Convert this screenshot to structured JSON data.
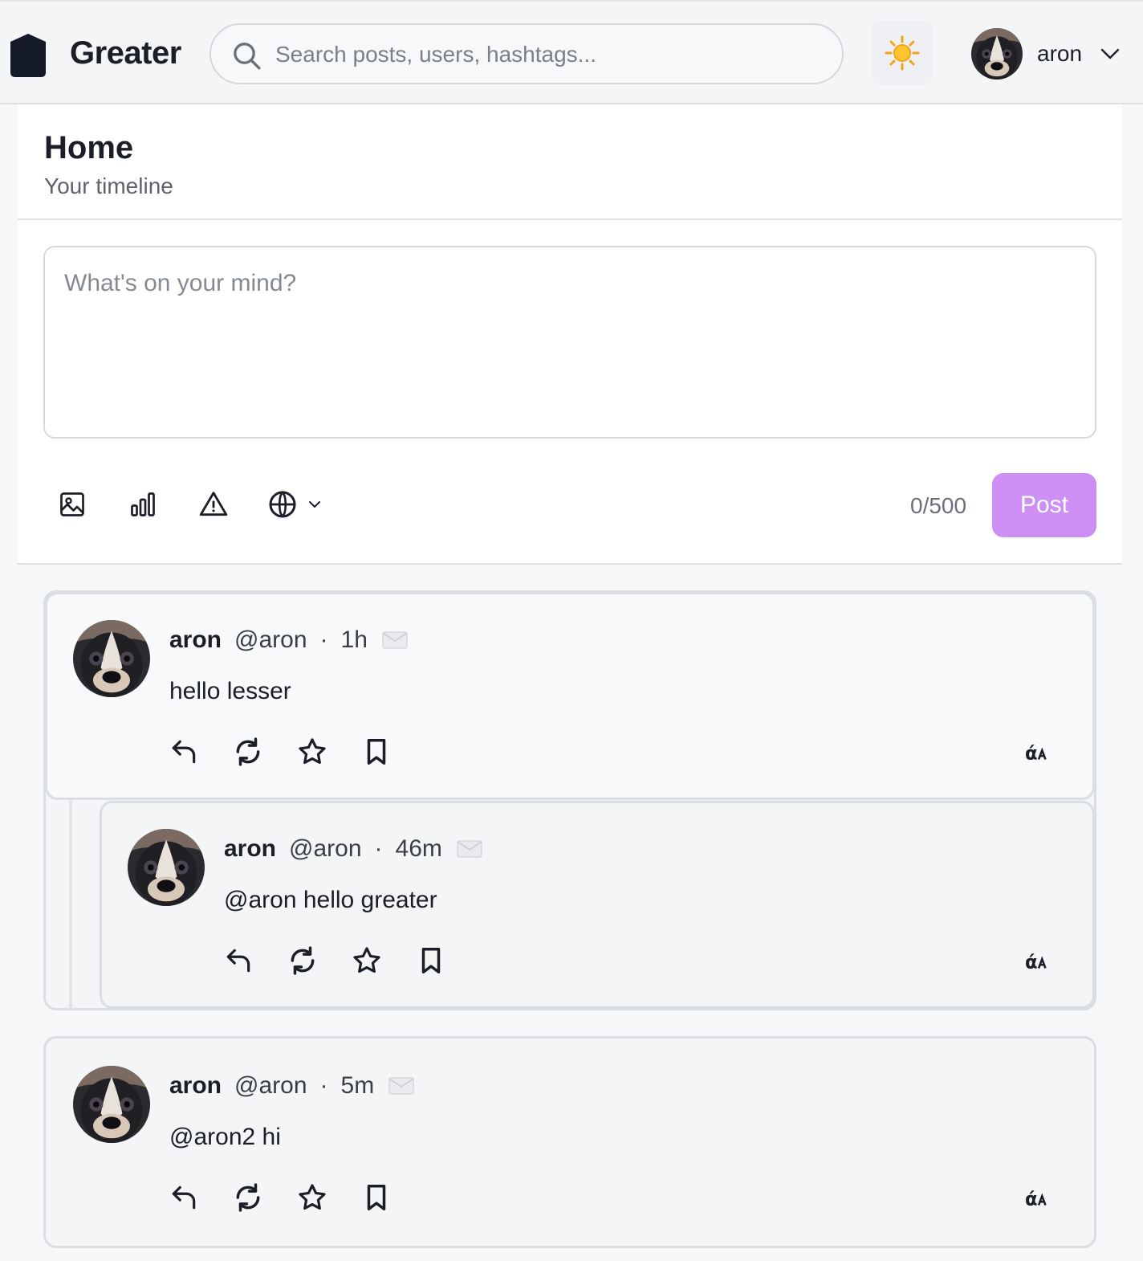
{
  "app": {
    "name": "Greater"
  },
  "search": {
    "placeholder": "Search posts, users, hashtags..."
  },
  "theme_toggle": {
    "icon": "sun-icon"
  },
  "user": {
    "name": "aron"
  },
  "page": {
    "title": "Home",
    "subtitle": "Your timeline"
  },
  "composer": {
    "placeholder": "What's on your mind?",
    "counter": "0/500",
    "post_label": "Post",
    "tools": [
      "image-icon",
      "poll-icon",
      "warning-icon",
      "globe-icon"
    ]
  },
  "colors": {
    "accent": "#cd8ff3",
    "text": "#1b1e27",
    "muted": "#6a6f78"
  },
  "posts": [
    {
      "display_name": "aron",
      "handle": "@aron",
      "dot": "·",
      "time": "1h",
      "text": "hello lesser"
    },
    {
      "display_name": "aron",
      "handle": "@aron",
      "dot": "·",
      "time": "46m",
      "text": "@aron hello greater"
    },
    {
      "display_name": "aron",
      "handle": "@aron",
      "dot": "·",
      "time": "5m",
      "text": "@aron2 hi"
    }
  ]
}
